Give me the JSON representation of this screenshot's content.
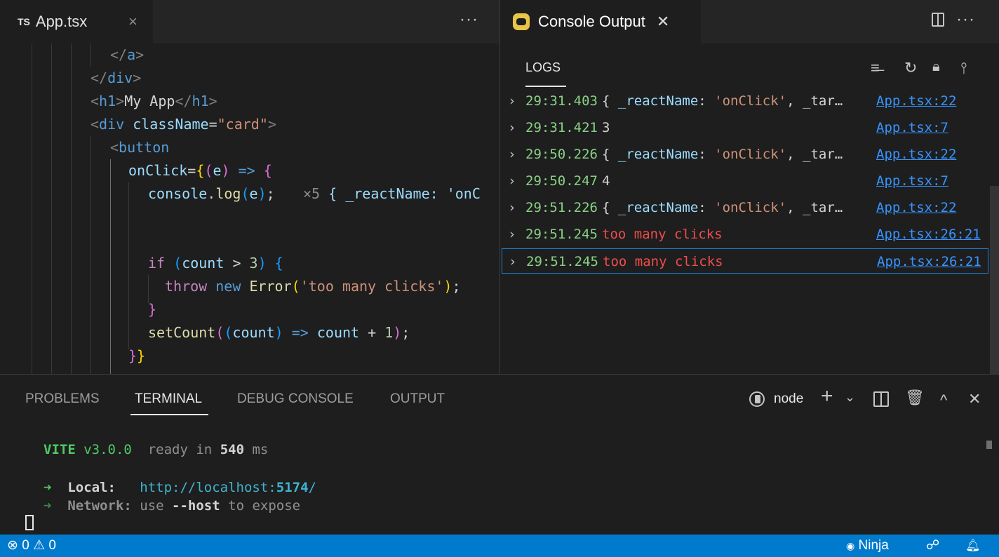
{
  "editor": {
    "tab": {
      "badge": "TS",
      "filename": "App.tsx",
      "close": "×"
    },
    "more": "···",
    "inline_hint": {
      "count": "×5",
      "preview": "{ _reactName: 'onC"
    },
    "code": {
      "l1": {
        "open": "</",
        "el": "a",
        "close": ">"
      },
      "l2": {
        "open": "</",
        "el": "div",
        "close": ">"
      },
      "l3": {
        "o1": "<",
        "el": "h1",
        "c1": ">",
        "text": "My App",
        "o2": "</",
        "el2": "h1",
        "c2": ">"
      },
      "l4": {
        "o1": "<",
        "el": "div",
        "attr": "className",
        "eq": "=",
        "val": "\"card\"",
        "c1": ">"
      },
      "l5": {
        "o1": "<",
        "el": "button"
      },
      "l6": {
        "attr": "onClick",
        "eq": "=",
        "b1": "{",
        "p1": "(",
        "param": "e",
        "p2": ")",
        "arrow": " => ",
        "b2": "{"
      },
      "l7": {
        "obj": "console",
        "dot": ".",
        "fn": "log",
        "p1": "(",
        "arg": "e",
        "p2": ")",
        "semi": ";"
      },
      "l8": {
        "kw": "if",
        "sp": " (",
        "var": "count",
        "op": " > ",
        "num": "3",
        "rp": ") ",
        "b": "{"
      },
      "l9": {
        "kw": "throw",
        "kw2": " new ",
        "fn": "Error",
        "p1": "(",
        "str": "'too many clicks'",
        "p2": ")",
        "semi": ";"
      },
      "l10": {
        "b": "}"
      },
      "l11": {
        "fn": "setCount",
        "p1": "(",
        "p2": "(",
        "param": "count",
        "p3": ")",
        "arrow": " => ",
        "var": "count",
        "op": " + ",
        "num": "1",
        "p4": ")",
        "p5": ")",
        "semi": ";"
      },
      "l12": {
        "b1": "}",
        "b2": "}"
      }
    }
  },
  "console": {
    "tab": {
      "label": "Console Output",
      "close": "✕"
    },
    "more": "···",
    "logs_label": "LOGS",
    "toolbar": {
      "clear": "≡̶",
      "refresh": "↻",
      "lock": "🔒︎",
      "filter": "⫯"
    },
    "rows": [
      {
        "chevron": "›",
        "time": "29:31.403",
        "msg_pre": "{ ",
        "msg_key": "_reactName",
        "msg_mid": ": ",
        "msg_val": "'onClick'",
        "msg_post": ", _tar…",
        "link": "App.tsx:22"
      },
      {
        "chevron": "›",
        "time": "29:31.421",
        "msg": "3",
        "link": "App.tsx:7"
      },
      {
        "chevron": "›",
        "time": "29:50.226",
        "msg_pre": "{ ",
        "msg_key": "_reactName",
        "msg_mid": ": ",
        "msg_val": "'onClick'",
        "msg_post": ", _tar…",
        "link": "App.tsx:22"
      },
      {
        "chevron": "›",
        "time": "29:50.247",
        "msg": "4",
        "link": "App.tsx:7"
      },
      {
        "chevron": "›",
        "time": "29:51.226",
        "msg_pre": "{ ",
        "msg_key": "_reactName",
        "msg_mid": ": ",
        "msg_val": "'onClick'",
        "msg_post": ", _tar…",
        "link": "App.tsx:22"
      },
      {
        "chevron": "›",
        "time": "29:51.245",
        "msg": "too many clicks",
        "link": "App.tsx:26:21"
      },
      {
        "chevron": "›",
        "time": "29:51.245",
        "msg": "too many clicks",
        "link": "App.tsx:26:21"
      }
    ]
  },
  "panel": {
    "tabs": [
      "PROBLEMS",
      "TERMINAL",
      "DEBUG CONSOLE",
      "OUTPUT"
    ],
    "active_tab": "TERMINAL",
    "terminal_name": "node",
    "tools": {
      "add": "+",
      "dropdown": "⌄",
      "trash": "🗑︎",
      "maximize": "^",
      "close": "✕"
    },
    "terminal": {
      "vite": "VITE",
      "version": " v3.0.0",
      "ready": "  ready in ",
      "ms_num": "540",
      "ms": " ms",
      "arrow": "➜",
      "local_label": "  Local:",
      "local_url_pre": "   http://localhost:",
      "local_port": "5174",
      "local_url_post": "/",
      "network_label": "  Network:",
      "network_use": " use ",
      "network_flag": "--host",
      "network_post": " to expose"
    }
  },
  "statusbar": {
    "errors_icon": "⊗",
    "errors": "0",
    "warnings_icon": "⚠",
    "warnings": "0",
    "ninja_icon": "◉",
    "ninja": "Ninja",
    "accounts_icon": "☍",
    "bell_icon": "🔔︎"
  },
  "colors": {
    "statusbar": "#007acc",
    "editor_bg": "#1e1e1e",
    "tabbar_bg": "#252526",
    "error_text": "#f14c4c",
    "timestamp": "#89d185",
    "link": "#3794ff"
  }
}
